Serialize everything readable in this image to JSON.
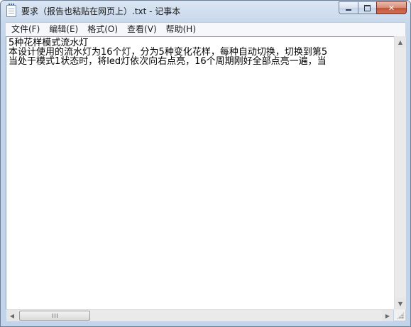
{
  "window": {
    "title": "要求（报告也粘贴在网页上）.txt - 记事本"
  },
  "caption_buttons": {
    "minimize_icon": "minimize-icon",
    "maximize_icon": "maximize-icon",
    "close_icon": "close-icon",
    "close_glyph": "✕"
  },
  "menu": {
    "items": [
      {
        "label": "文件(F)"
      },
      {
        "label": "编辑(E)"
      },
      {
        "label": "格式(O)"
      },
      {
        "label": "查看(V)"
      },
      {
        "label": "帮助(H)"
      }
    ]
  },
  "document": {
    "lines": [
      "5种花样模式流水灯",
      "本设计使用的流水灯为16个灯，分为5种变化花样，每种自动切换，切换到第5",
      "当处于模式1状态时，将led灯依次向右点亮，16个周期刚好全部点亮一遍，当"
    ]
  },
  "scrollbars": {
    "up_arrow": "▲",
    "down_arrow": "▼",
    "left_arrow": "◀",
    "right_arrow": "▶"
  }
}
